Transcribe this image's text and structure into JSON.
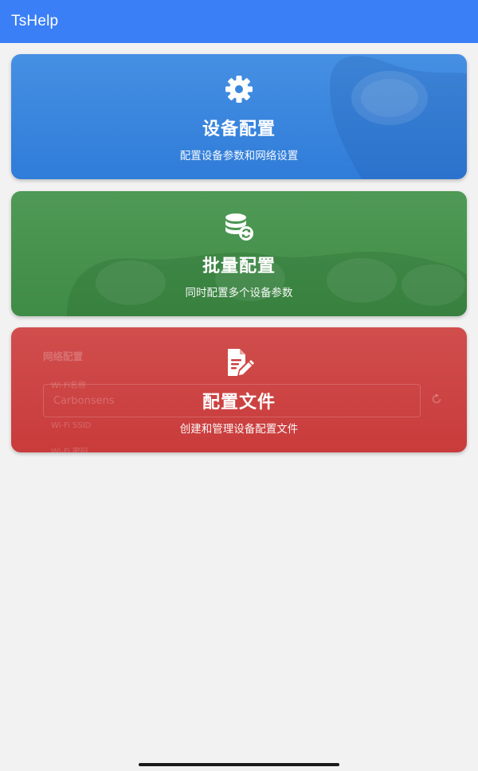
{
  "app": {
    "title": "TsHelp"
  },
  "cards": [
    {
      "title": "设备配置",
      "subtitle": "配置设备参数和网络设置",
      "icon": "gear-icon",
      "color": "#2f7cd9"
    },
    {
      "title": "批量配置",
      "subtitle": "同时配置多个设备参数",
      "icon": "database-sync-icon",
      "color": "#3f8c46"
    },
    {
      "title": "配置文件",
      "subtitle": "创建和管理设备配置文件",
      "icon": "file-edit-icon",
      "color": "#c93b3b"
    }
  ],
  "red_card_background": {
    "section_label": "网络配置",
    "wifi_name_label": "Wi-Fi名称",
    "wifi_name_value": "Carbonsens",
    "wifi_ssid_label": "Wi-Fi SSID",
    "wifi_password_label": "Wi-Fi 密码"
  }
}
